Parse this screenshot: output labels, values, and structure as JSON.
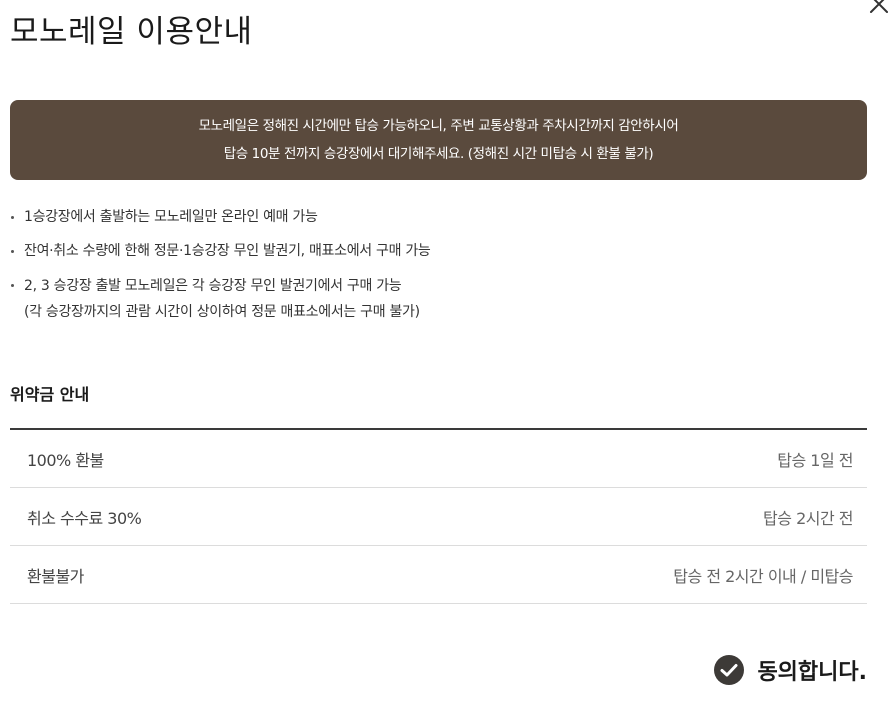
{
  "dialog": {
    "title": "모노레일 이용안내"
  },
  "notice": {
    "line1": "모노레일은 정해진 시간에만 탑승 가능하오니, 주변 교통상황과 주차시간까지 감안하시어",
    "line2": "탑승 10분 전까지 승강장에서 대기해주세요. (정해진 시간 미탑승 시 환불 불가)",
    "background_color": "#5a4a3d"
  },
  "bullets": [
    {
      "text": "1승강장에서 출발하는 모노레일만 온라인 예매 가능"
    },
    {
      "text": "잔여·취소 수량에 한해 정문·1승강장 무인 발권기, 매표소에서 구매 가능"
    },
    {
      "text": "2, 3 승강장 출발 모노레일은 각 승강장 무인 발권기에서 구매 가능",
      "sub": "(각 승강장까지의 관람 시간이 상이하여 정문 매표소에서는 구매 불가)"
    }
  ],
  "penalty": {
    "title": "위약금 안내",
    "rows": [
      {
        "label": "100% 환불",
        "value": "탑승 1일 전"
      },
      {
        "label": "취소 수수료 30%",
        "value": "탑승 2시간 전"
      },
      {
        "label": "환불불가",
        "value": "탑승 전 2시간 이내 / 미탑승"
      }
    ]
  },
  "agree": {
    "label": "동의합니다.",
    "checked": true,
    "icon": "check-circle-icon"
  },
  "close": {
    "icon": "close-icon"
  }
}
